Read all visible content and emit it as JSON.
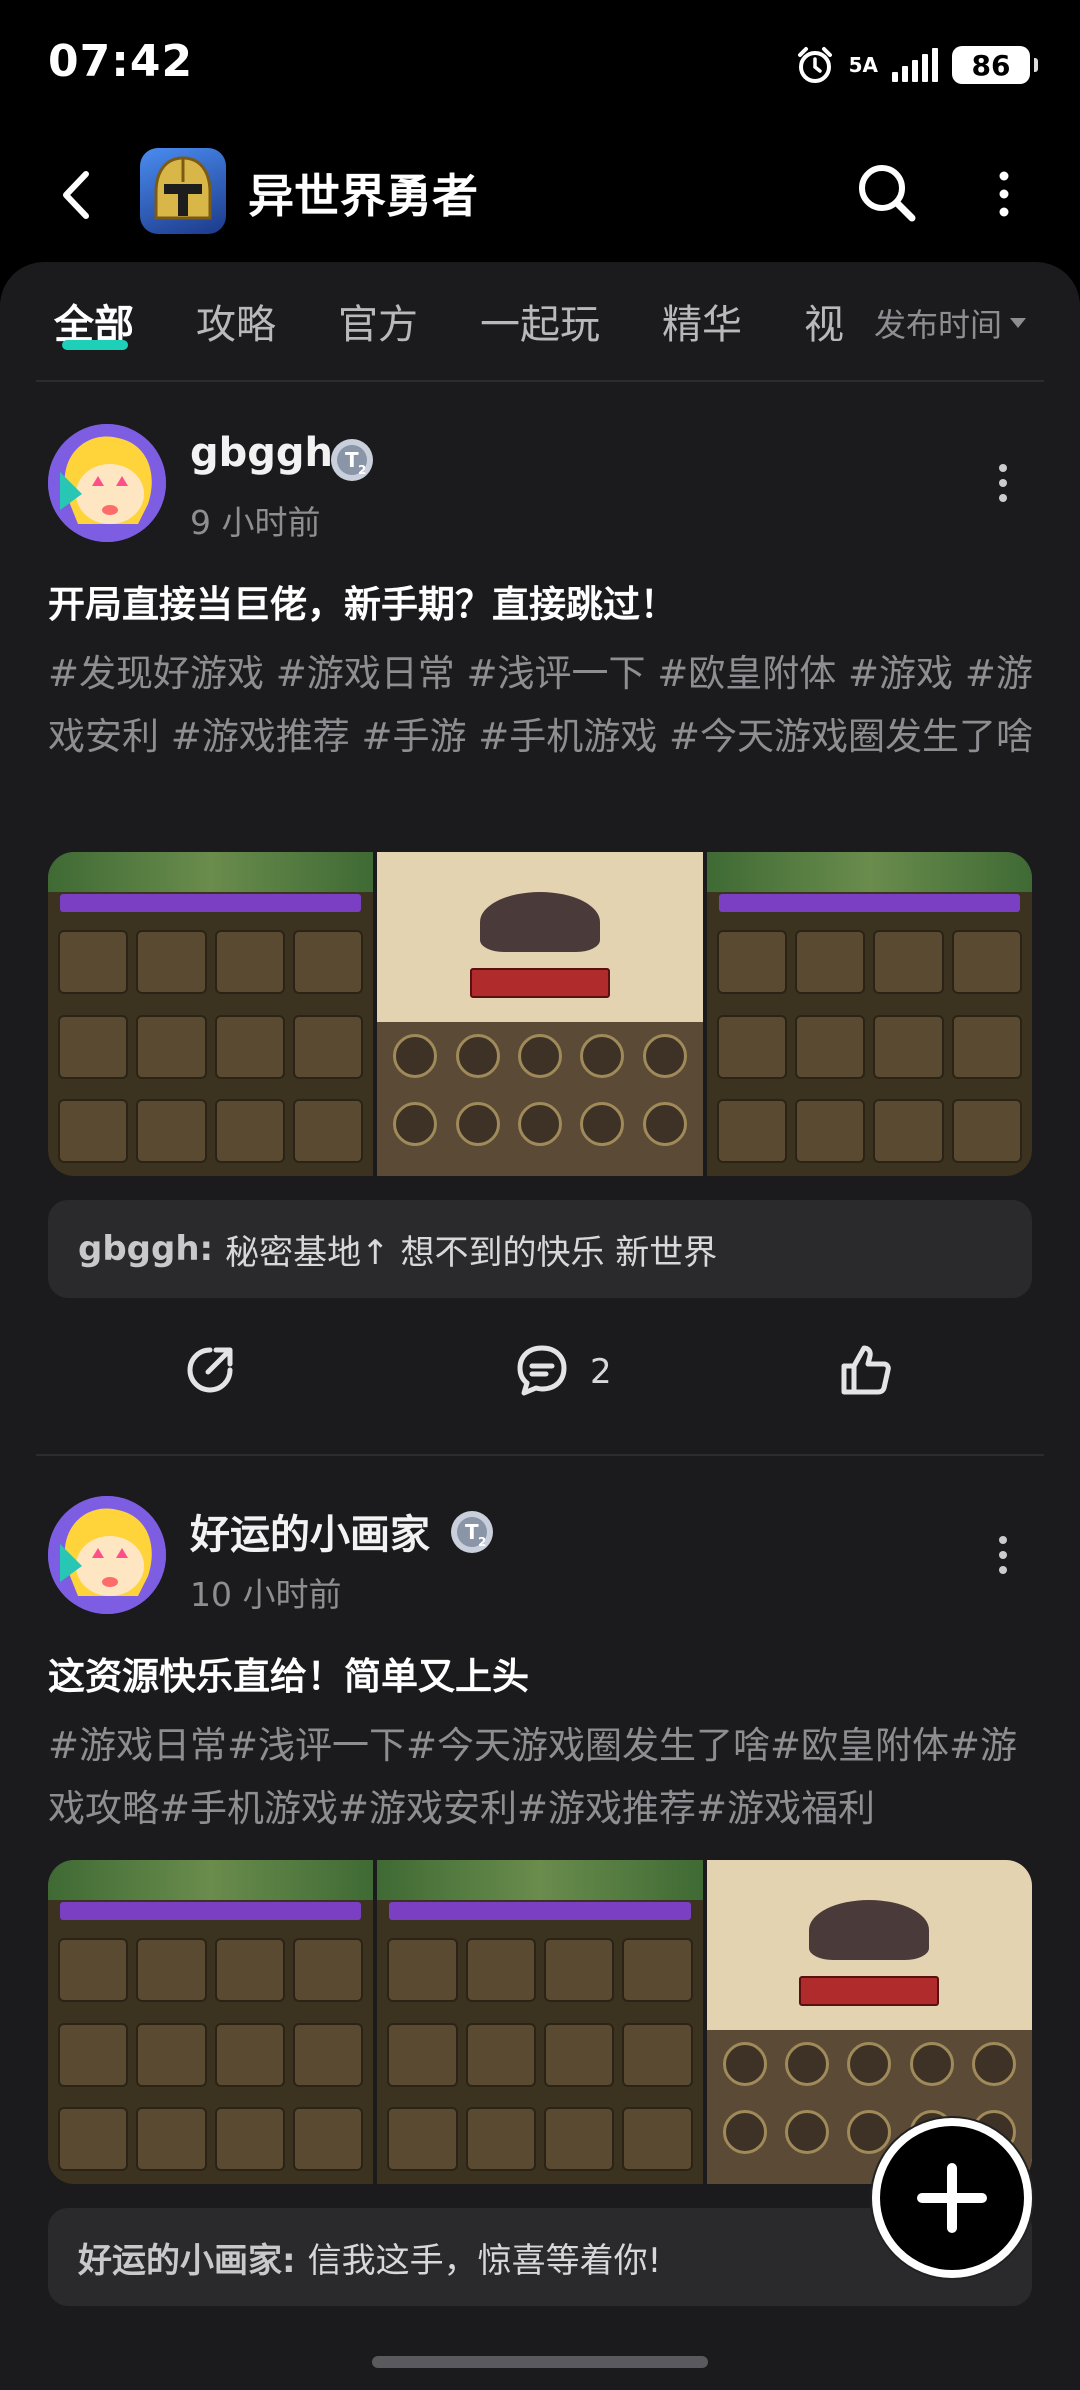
{
  "status_bar": {
    "time": "07:42",
    "network": "5A",
    "battery": "86"
  },
  "header": {
    "title": "异世界勇者"
  },
  "tabs": [
    {
      "label": "全部",
      "active": true
    },
    {
      "label": "攻略"
    },
    {
      "label": "官方"
    },
    {
      "label": "一起玩"
    },
    {
      "label": "精华"
    },
    {
      "label": "视"
    }
  ],
  "sort": {
    "label": "发布时间"
  },
  "posts": [
    {
      "author": "gbggh",
      "time": "9 小时前",
      "title": "开局直接当巨佬，新手期？直接跳过！",
      "tags": "#发现好游戏 #游戏日常 #浅评一下 #欧皇附体 #游戏 #游戏安利 #游戏推荐 #手游 #手机游戏 #今天游戏圈发生了啥",
      "comment_author": "gbggh:",
      "comment_text": "秘密基地↑  想不到的快乐  新世界",
      "comment_count": "2"
    },
    {
      "author": "好运的小画家",
      "time": "10 小时前",
      "title": "这资源快乐直给！简单又上头",
      "tags": "#游戏日常#浅评一下#今天游戏圈发生了啥#欧皇附体#游戏攻略#手机游戏#游戏安利#游戏推荐#游戏福利",
      "comment_author": "好运的小画家:",
      "comment_text": "信我这手，惊喜等着你!"
    }
  ],
  "colors": {
    "accent": "#1fd0b9",
    "panel": "#1b1b1d",
    "muted": "#8e8e92"
  }
}
